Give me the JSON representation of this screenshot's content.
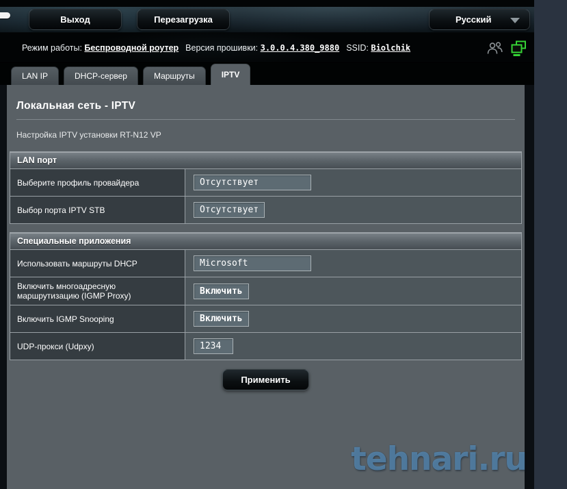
{
  "colors": {
    "panel_gray": "#596065",
    "accent_green": "#35d435",
    "watermark_blue": "#679cc7",
    "row_label_bg": "#353c41",
    "row_value_bg": "#4d565b"
  },
  "header": {
    "logout_label": "Выход",
    "reboot_label": "Перезагрузка",
    "language_selected": "Русский"
  },
  "infobar": {
    "mode_label": "Режим работы:",
    "mode_value": "Беспроводной роутер",
    "firmware_label": "Версия прошивки:",
    "firmware_value": "3.0.0.4.380_9880",
    "ssid_label": "SSID:",
    "ssid_value": "Biolchik",
    "icons": [
      "clients-icon",
      "network-map-icon"
    ]
  },
  "tabs": [
    {
      "id": "lan-ip",
      "label": "LAN IP",
      "active": false
    },
    {
      "id": "dhcp-server",
      "label": "DHCP-сервер",
      "active": false
    },
    {
      "id": "routes",
      "label": "Маршруты",
      "active": false
    },
    {
      "id": "iptv",
      "label": "IPTV",
      "active": true
    }
  ],
  "page": {
    "title": "Локальная сеть - IPTV",
    "subtitle": "Настройка IPTV установки RT-N12 VP",
    "apply_label": "Применить",
    "watermark": "tehnari.ru"
  },
  "sections": [
    {
      "title": "LAN порт",
      "rows": [
        {
          "label": "Выберите профиль провайдера",
          "control": "select",
          "value": "Отсутствует",
          "wide": true,
          "name": "isp-profile-select"
        },
        {
          "label": "Выбор порта IPTV STB",
          "control": "select",
          "value": "Отсутствует",
          "wide": false,
          "name": "iptv-stb-port-select"
        }
      ]
    },
    {
      "title": "Специальные приложения",
      "rows": [
        {
          "label": "Использовать маршруты DHCP",
          "control": "select",
          "value": "Microsoft",
          "wide": true,
          "name": "dhcp-routes-select"
        },
        {
          "label": "Включить многоадресную маршрутизацию (IGMP Proxy)",
          "control": "button",
          "value": "Включить",
          "wide": false,
          "name": "igmp-proxy-toggle"
        },
        {
          "label": "Включить IGMP Snooping",
          "control": "button",
          "value": "Включить",
          "wide": false,
          "name": "igmp-snooping-toggle"
        },
        {
          "label": "UDP-прокси (Udpxy)",
          "control": "input",
          "value": "1234",
          "wide": false,
          "name": "udp-proxy-input"
        }
      ]
    }
  ]
}
